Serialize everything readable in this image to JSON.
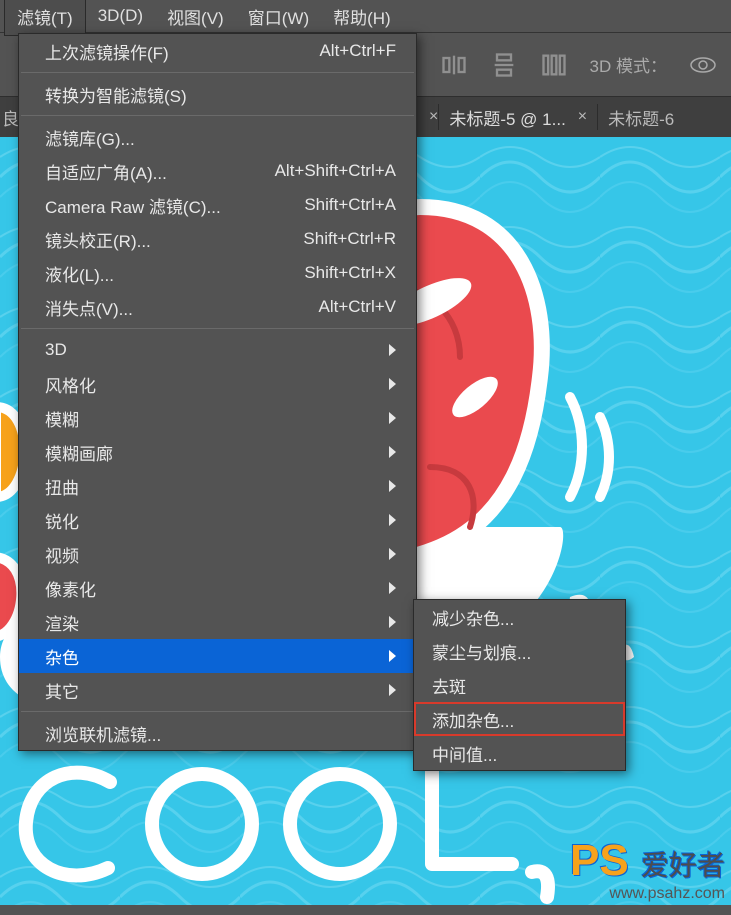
{
  "menubar": {
    "filter": "滤镜(T)",
    "threeD": "3D(D)",
    "view": "视图(V)",
    "window": "窗口(W)",
    "help": "帮助(H)"
  },
  "toolbar": {
    "mode_label": "3D 模式："
  },
  "tabs": {
    "partial_left": "良",
    "tab1": "未标题-5 @ 1...",
    "tab2": "未标题-6"
  },
  "menu": {
    "last_filter": "上次滤镜操作(F)",
    "last_filter_sc": "Alt+Ctrl+F",
    "smart": "转换为智能滤镜(S)",
    "gallery": "滤镜库(G)...",
    "adaptive": "自适应广角(A)...",
    "adaptive_sc": "Alt+Shift+Ctrl+A",
    "camera": "Camera Raw 滤镜(C)...",
    "camera_sc": "Shift+Ctrl+A",
    "lens": "镜头校正(R)...",
    "lens_sc": "Shift+Ctrl+R",
    "liquify": "液化(L)...",
    "liquify_sc": "Shift+Ctrl+X",
    "vanish": "消失点(V)...",
    "vanish_sc": "Alt+Ctrl+V",
    "threeD": "3D",
    "stylize": "风格化",
    "blur": "模糊",
    "blur_gallery": "模糊画廊",
    "distort": "扭曲",
    "sharpen": "锐化",
    "video": "视频",
    "pixelate": "像素化",
    "render": "渲染",
    "noise": "杂色",
    "other": "其它",
    "browse": "浏览联机滤镜..."
  },
  "submenu": {
    "reduce": "减少杂色...",
    "dust": "蒙尘与划痕...",
    "despeckle": "去斑",
    "add": "添加杂色...",
    "median": "中间值..."
  },
  "canvas": {
    "cool_text": "COOL"
  },
  "watermark": {
    "logo_ps": "PS",
    "logo_cn": "爱好者",
    "url": "www.psahz.com"
  }
}
